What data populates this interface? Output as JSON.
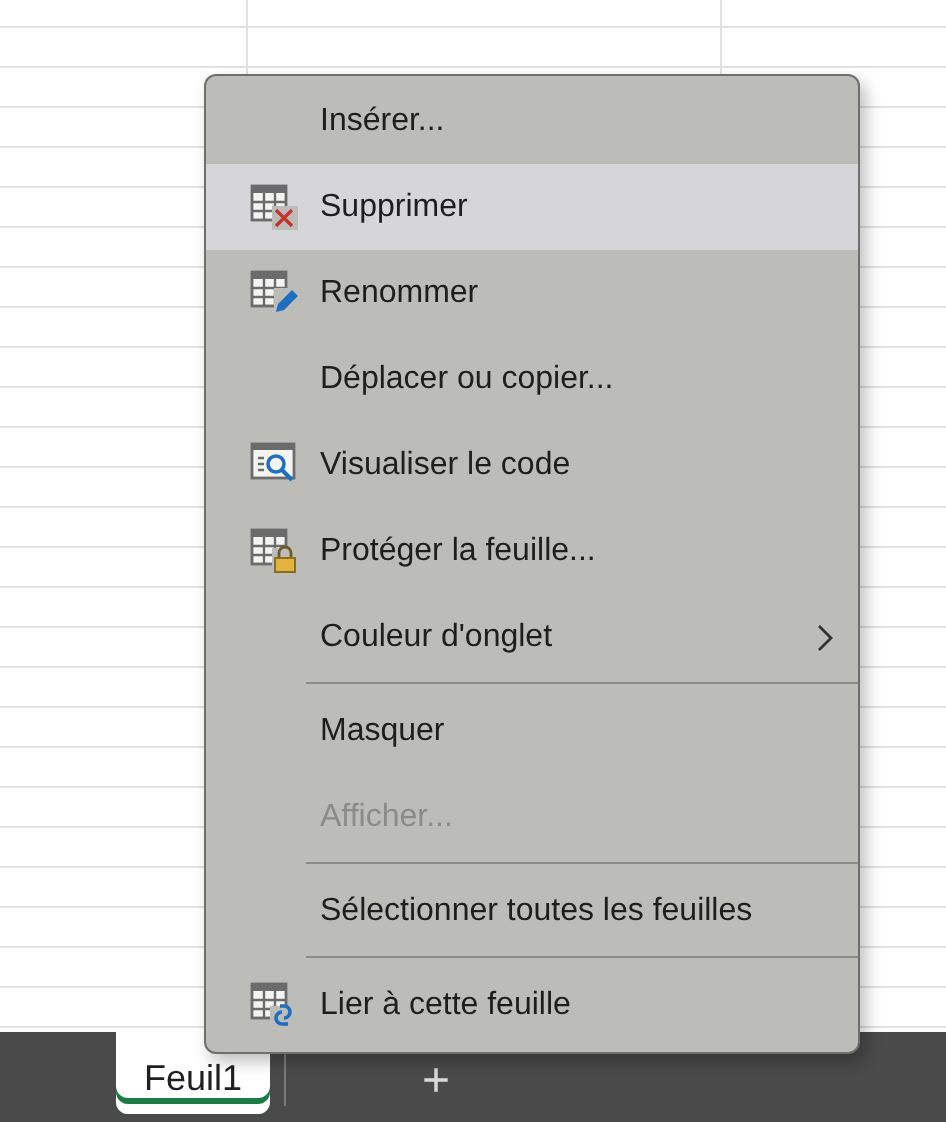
{
  "context_menu": {
    "items": [
      {
        "kind": "item",
        "label": "Insérer...",
        "has_icon": false,
        "selected": false,
        "disabled": false,
        "submenu": false
      },
      {
        "kind": "item",
        "label": "Supprimer",
        "has_icon": true,
        "selected": true,
        "disabled": false,
        "submenu": false
      },
      {
        "kind": "item",
        "label": "Renommer",
        "has_icon": true,
        "selected": false,
        "disabled": false,
        "submenu": false
      },
      {
        "kind": "item",
        "label": "Déplacer ou copier...",
        "has_icon": false,
        "selected": false,
        "disabled": false,
        "submenu": false
      },
      {
        "kind": "item",
        "label": "Visualiser le code",
        "has_icon": true,
        "selected": false,
        "disabled": false,
        "submenu": false
      },
      {
        "kind": "item",
        "label": "Protéger la feuille...",
        "has_icon": true,
        "selected": false,
        "disabled": false,
        "submenu": false
      },
      {
        "kind": "item",
        "label": "Couleur d'onglet",
        "has_icon": false,
        "selected": false,
        "disabled": false,
        "submenu": true
      },
      {
        "kind": "separator"
      },
      {
        "kind": "item",
        "label": "Masquer",
        "has_icon": false,
        "selected": false,
        "disabled": false,
        "submenu": false
      },
      {
        "kind": "item",
        "label": "Afficher...",
        "has_icon": false,
        "selected": false,
        "disabled": true,
        "submenu": false
      },
      {
        "kind": "separator"
      },
      {
        "kind": "item",
        "label": "Sélectionner toutes les feuilles",
        "has_icon": false,
        "selected": false,
        "disabled": false,
        "submenu": false
      },
      {
        "kind": "separator"
      },
      {
        "kind": "item",
        "label": "Lier à cette feuille",
        "has_icon": true,
        "selected": false,
        "disabled": false,
        "submenu": false
      }
    ]
  },
  "sheet_tabs": [
    {
      "label": "Feuil1",
      "selected": true
    }
  ],
  "add_sheet_button": "+"
}
